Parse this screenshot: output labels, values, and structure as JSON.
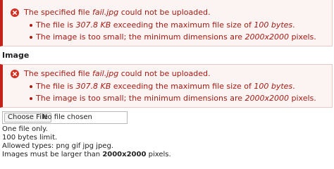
{
  "messages": [
    {
      "title_prefix": "The specified file ",
      "filename": "fail.jpg",
      "title_suffix": " could not be uploaded.",
      "items": [
        {
          "a": "The file is ",
          "b": "307.8 KB",
          "c": " exceeding the maximum file size of ",
          "d": "100 bytes",
          "e": "."
        },
        {
          "a": "The image is too small; the minimum dimensions are ",
          "b": "2000x2000",
          "c": " pixels."
        }
      ]
    },
    {
      "title_prefix": "The specified file ",
      "filename": "fail.jpg",
      "title_suffix": " could not be uploaded.",
      "items": [
        {
          "a": "The file is ",
          "b": "307.8 KB",
          "c": " exceeding the maximum file size of ",
          "d": "100 bytes",
          "e": "."
        },
        {
          "a": "The image is too small; the minimum dimensions are ",
          "b": "2000x2000",
          "c": " pixels."
        }
      ]
    }
  ],
  "field": {
    "label": "Image",
    "choose_button": "Choose File",
    "status": "No file chosen"
  },
  "description": {
    "line1": "One file only.",
    "line2": "100 bytes limit.",
    "line3": "Allowed types: png gif jpg jpeg.",
    "line4_prefix": "Images must be larger than ",
    "line4_bold": "2000x2000",
    "line4_suffix": " pixels."
  },
  "colors": {
    "error_text": "#a51b12",
    "error_border": "#c4211b",
    "error_background": "#fcf3f3"
  },
  "icons": {
    "error": "error-x-circle-icon"
  }
}
